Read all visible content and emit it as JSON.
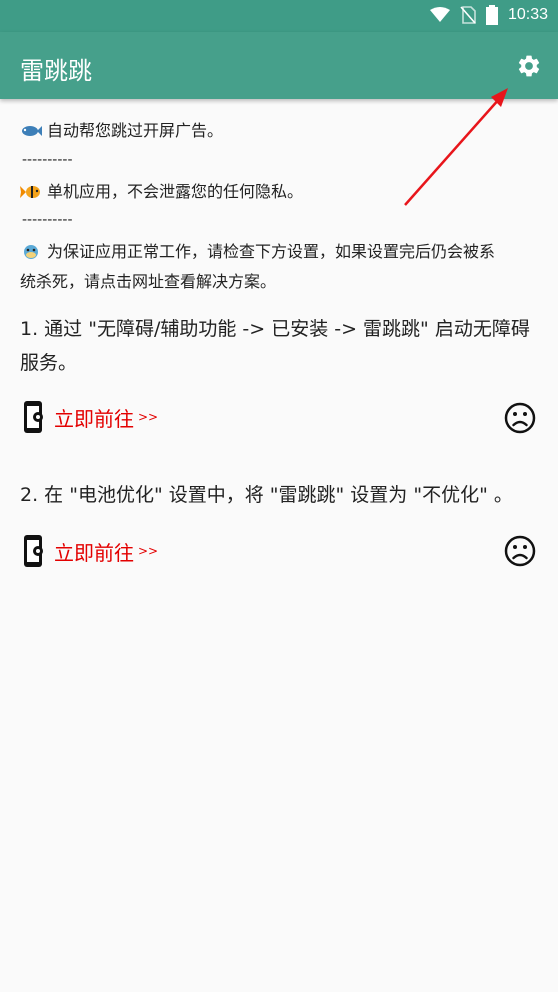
{
  "status_bar": {
    "time": "10:33",
    "icons": [
      "wifi-icon",
      "no-sim-icon",
      "battery-icon"
    ]
  },
  "app_bar": {
    "title": "雷跳跳",
    "settings_icon": "gear-icon"
  },
  "intro": {
    "line1": "自动帮您跳过开屏广告。",
    "separator": "----------",
    "line2": "单机应用，不会泄露您的任何隐私。",
    "line3a": "为保证应用正常工作，请检查下方设置，如果设置完后仍会被系",
    "line3b": "统杀死，请点击网址查看解决方案。"
  },
  "steps": [
    {
      "text_line1": "1. 通过 \"无障碍/辅助功能 -> 已安装 -> 雷跳跳\" 启动无障碍",
      "text_line2": "服务。",
      "action_label": "立即前往",
      "action_suffix": ">>",
      "status_icon": "sad-face-icon"
    },
    {
      "text_line1": "2. 在 \"电池优化\" 设置中，将 \"雷跳跳\" 设置为 \"不优化\" 。",
      "action_label": "立即前往",
      "action_suffix": ">>",
      "status_icon": "sad-face-icon"
    }
  ],
  "colors": {
    "status_bar": "#3f9c87",
    "app_bar": "#46a08b",
    "action_text": "#e30000",
    "annotation_arrow": "#e8151b"
  }
}
